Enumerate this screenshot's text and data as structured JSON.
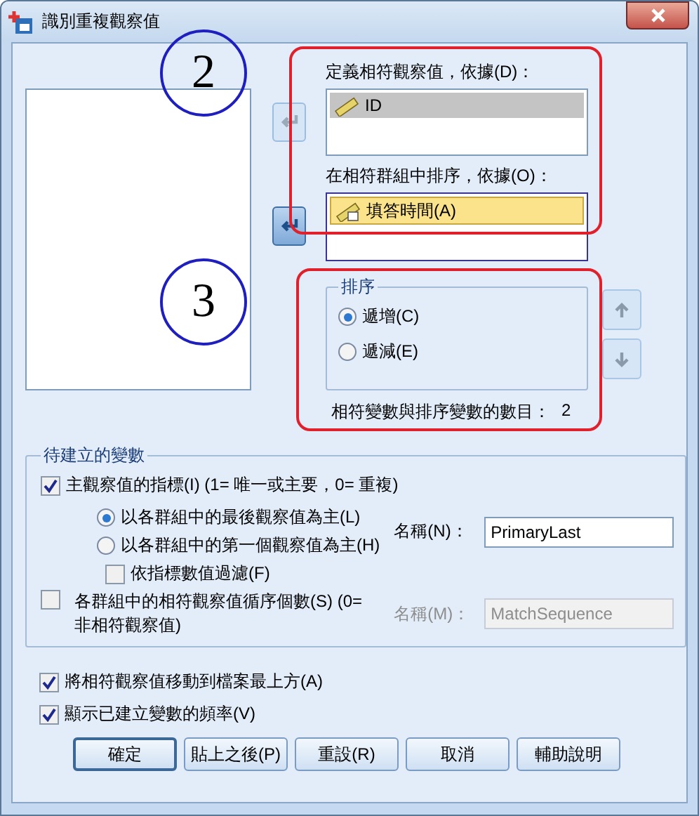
{
  "window": {
    "title": "識別重複觀察值"
  },
  "annotations": [
    {
      "label": "2"
    },
    {
      "label": "3"
    }
  ],
  "match_by": {
    "label": "定義相符觀察值，依據(D)：",
    "focused": false,
    "arrow_disabled": true,
    "items": [
      {
        "name": "ID",
        "kind": "scale",
        "selected": true
      }
    ]
  },
  "sort_within": {
    "label": "在相符群組中排序，依據(O)：",
    "focused": true,
    "arrow_disabled": false,
    "items": [
      {
        "name": "填答時間(A)",
        "kind": "date",
        "selected": true
      }
    ]
  },
  "sort": {
    "title": "排序",
    "options": [
      {
        "label": "遞增(C)",
        "selected": true
      },
      {
        "label": "遞減(E)",
        "selected": false
      }
    ]
  },
  "count": {
    "label": "相符變數與排序變數的數目：",
    "value": "2"
  },
  "new_variables": {
    "title": "待建立的變數",
    "primary": {
      "label": "主觀察值的指標(I) (1= 唯一或主要，0= 重複)",
      "checked": true,
      "options": [
        {
          "label": "以各群組中的最後觀察值為主(L)",
          "selected": true
        },
        {
          "label": "以各群組中的第一個觀察值為主(H)",
          "selected": false
        }
      ],
      "filter": {
        "label": "依指標數值過濾(F)",
        "checked": false
      },
      "name_label": "名稱(N)：",
      "name_value": "PrimaryLast",
      "disabled": false
    },
    "sequence": {
      "label": "各群組中的相符觀察值循序個數(S) (0= 非相符觀察值)",
      "checked": false,
      "name_label": "名稱(M)：",
      "name_value": "MatchSequence",
      "disabled": true
    }
  },
  "options": [
    {
      "label": "將相符觀察值移動到檔案最上方(A)",
      "checked": true
    },
    {
      "label": "顯示已建立變數的頻率(V)",
      "checked": true
    }
  ],
  "buttons": [
    {
      "label": "確定",
      "default": true
    },
    {
      "label": "貼上之後(P)",
      "default": false
    },
    {
      "label": "重設(R)",
      "default": false
    },
    {
      "label": "取消",
      "default": false
    },
    {
      "label": "輔助說明",
      "default": false
    }
  ]
}
